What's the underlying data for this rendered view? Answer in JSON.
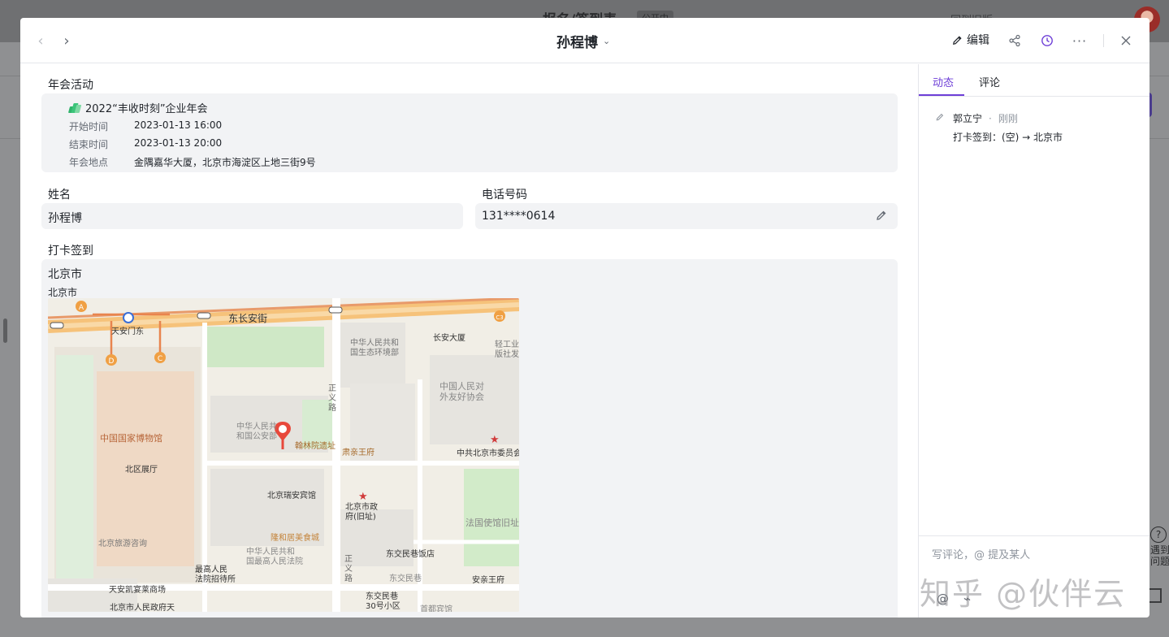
{
  "background": {
    "title": "报名/签到表",
    "badge": "公开中",
    "right_text": "回到旧版",
    "help_label": "遇到\n问题"
  },
  "modal": {
    "title": "孙程博",
    "edit_label": "编辑",
    "icons": {
      "prev": "chevron-left-icon",
      "next": "chevron-right-icon",
      "share": "share-icon",
      "history": "clock-icon",
      "more": "more-icon",
      "close": "close-icon"
    }
  },
  "fields": {
    "event": {
      "label": "年会活动",
      "name": "2022“丰收时刻”企业年会",
      "rows": [
        {
          "key": "开始时间",
          "value": "2023-01-13 16:00"
        },
        {
          "key": "结束时间",
          "value": "2023-01-13 20:00"
        },
        {
          "key": "年会地点",
          "value": "金隅嘉华大厦，北京市海淀区上地三街9号"
        }
      ]
    },
    "name": {
      "label": "姓名",
      "value": "孙程博"
    },
    "phone": {
      "label": "电话号码",
      "value": "131****0614"
    },
    "checkin": {
      "label": "打卡签到",
      "location_title": "北京市",
      "location_sub": "北京市"
    }
  },
  "map_labels": {
    "road_main": "东长安街",
    "tiananmen_east": "天安门东",
    "env_ministry": "中华人民共和\n国生态环境部",
    "changan_building": "长安大厦",
    "light_industry": "轻工业\n版社发",
    "friendship_assoc": "中国人民对\n外友好协会",
    "national_museum": "中国国家博物馆",
    "north_hall": "北区展厅",
    "public_security": "中华人民共\n和国公安部",
    "hanlin": "翰林院遗址",
    "suqin": "肃亲王府",
    "party_committee": "中共北京市委员会",
    "zhengyi_road": "正\n义\n路",
    "ruian_hotel": "北京瑞安宾馆",
    "city_gov": "北京市政\n府(旧址)",
    "french_embassy": "法国使馆旧址",
    "tourism": "北京旅游咨询",
    "longhe": "隆和居美食城",
    "supreme_court": "中华人民共和\n国最高人民法院",
    "dongjiao_hotel": "东交民巷饭店",
    "supreme_proc": "最高人民\n法院招待所",
    "zhengyi_road2": "正\n义\n路",
    "dongjiao_lane": "东交民巷",
    "anding": "安亲王府",
    "kempinski": "天安凯宴莱商场",
    "congress": "北京市人民政府天",
    "dongjiao30": "东交民巷\n30号小区",
    "capital_hotel": "首都宾馆",
    "badges": [
      "A",
      "D",
      "C",
      "C3"
    ]
  },
  "side": {
    "tabs": [
      {
        "label": "动态",
        "active": true
      },
      {
        "label": "评论",
        "active": false
      }
    ],
    "activity": {
      "user": "郭立宁",
      "time": "刚刚",
      "text": "打卡签到：(空) → 北京市"
    },
    "comment_placeholder": "写评论，@ 提及某人"
  },
  "watermark": "知乎 @伙伴云",
  "colors": {
    "accent": "#6e3fd7",
    "pin": "#e8483b"
  }
}
